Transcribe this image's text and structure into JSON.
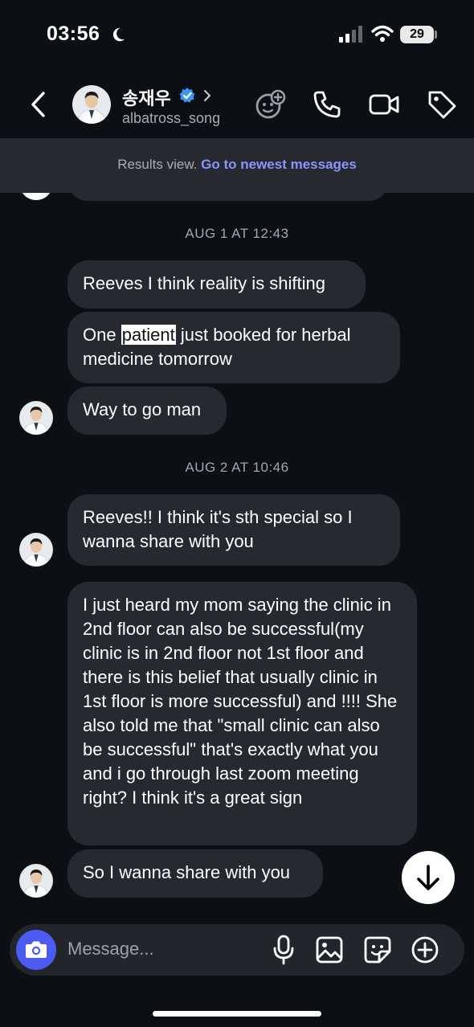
{
  "status_bar": {
    "time": "03:56",
    "battery": "29"
  },
  "header": {
    "name": "송재우",
    "username": "albatross_song"
  },
  "banner": {
    "prefix": "Results view.",
    "link": "Go to newest messages"
  },
  "messages": {
    "ts1": "AUG 1 AT 12:43",
    "m1": "Reeves I think reality is shifting",
    "m2_pre": "One ",
    "m2_hl": "patient",
    "m2_post": " just booked for herbal medicine tomorrow",
    "m3": "Way to go man",
    "ts2": "AUG 2 AT 10:46",
    "m4": "Reeves!! I think it's sth special so I wanna share with you",
    "m5": "I just heard my mom saying the clinic in 2nd floor can also be successful(my clinic is in 2nd floor not 1st floor and there is this belief that usually clinic in 1st floor is more successful) and !!!! She also told me that \"small clinic can also be successful\" that's exactly what you and i go through last zoom meeting right? I think it's a great sign",
    "m6": "So I wanna share with you"
  },
  "composer": {
    "placeholder": "Message..."
  },
  "colors": {
    "background": "#0c0f14",
    "bubble": "#262a30",
    "accent": "#4c5bf2",
    "link": "#8b93ff"
  }
}
